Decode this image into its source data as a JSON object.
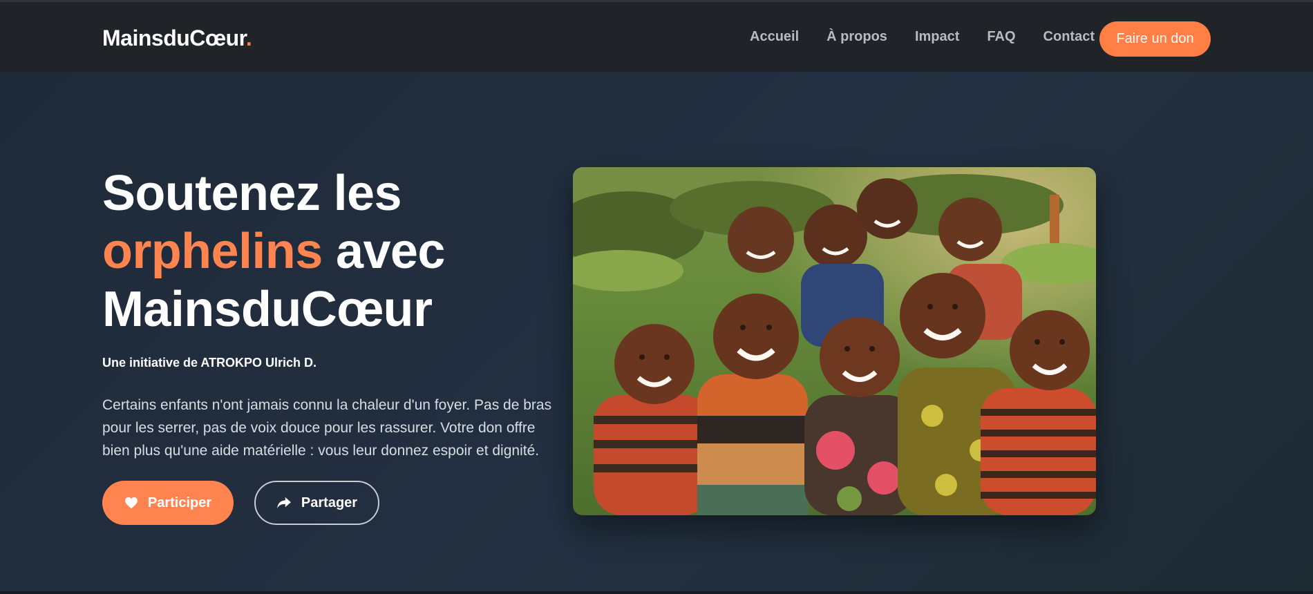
{
  "nav": {
    "brand_text": "MainsduCœur",
    "brand_dot": ".",
    "links": [
      "Accueil",
      "À propos",
      "Impact",
      "FAQ",
      "Contact"
    ],
    "cta_label": "Faire un don"
  },
  "hero": {
    "title_line1": "Soutenez les",
    "title_accent": "orphelins",
    "title_rest": " avec",
    "title_line3": "MainsduCœur",
    "initiative": "Une initiative de ATROKPO Ulrich D.",
    "description": "Certains enfants n'ont jamais connu la chaleur d'un foyer. Pas de bras pour les serrer, pas de voix douce pour les rassurer. Votre don offre bien plus qu'une aide matérielle : vous leur donnez espoir et dignité.",
    "primary_button": {
      "label": "Participer",
      "icon": "heart-icon"
    },
    "secondary_button": {
      "label": "Partager",
      "icon": "share-arrow-icon"
    }
  },
  "colors": {
    "accent": "#ff7f47",
    "nav_background": "#202328",
    "hero_background": "#222a35",
    "text_muted": "#b7bcc4"
  }
}
